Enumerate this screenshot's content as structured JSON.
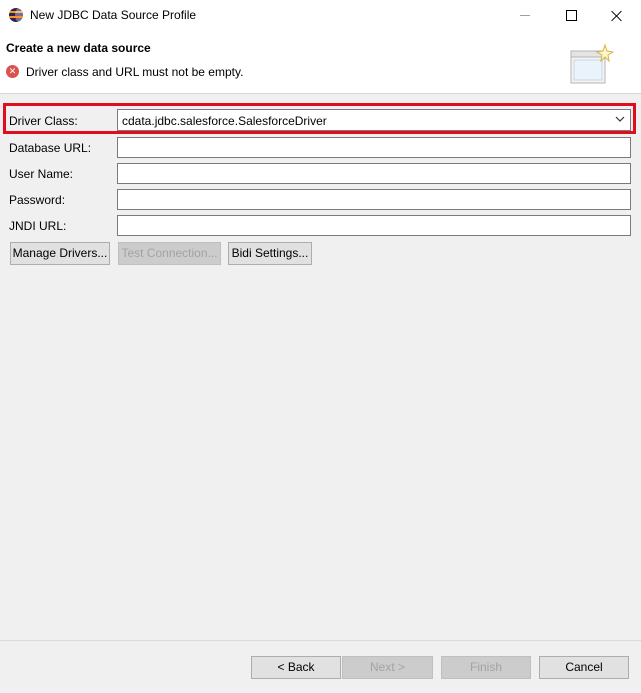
{
  "window": {
    "title": "New JDBC Data Source Profile",
    "app_icon": "eclipse-icon",
    "controls": [
      "minimize-icon",
      "maximize-icon",
      "close-icon"
    ]
  },
  "header": {
    "title": "Create a new data source",
    "error_icon": "error-icon",
    "message": "Driver class and URL must not be empty.",
    "banner_icon": "wizard-banner-icon"
  },
  "form": {
    "driver_class": {
      "label": "Driver Class:",
      "value": "cdata.jdbc.salesforce.SalesforceDriver",
      "dropdown_icon": "chevron-down-icon"
    },
    "database_url": {
      "label": "Database URL:",
      "value": ""
    },
    "user_name": {
      "label": "User Name:",
      "value": ""
    },
    "password": {
      "label": "Password:",
      "value": ""
    },
    "jndi_url": {
      "label": "JNDI URL:",
      "value": ""
    }
  },
  "actions": {
    "manage_drivers": "Manage Drivers...",
    "test_connection": "Test Connection...",
    "bidi_settings": "Bidi Settings..."
  },
  "footer": {
    "back": "< Back",
    "next": "Next >",
    "finish": "Finish",
    "cancel": "Cancel"
  },
  "colors": {
    "highlight": "#e00e1c",
    "error": "#d9534f",
    "background": "#f0f0f0"
  }
}
